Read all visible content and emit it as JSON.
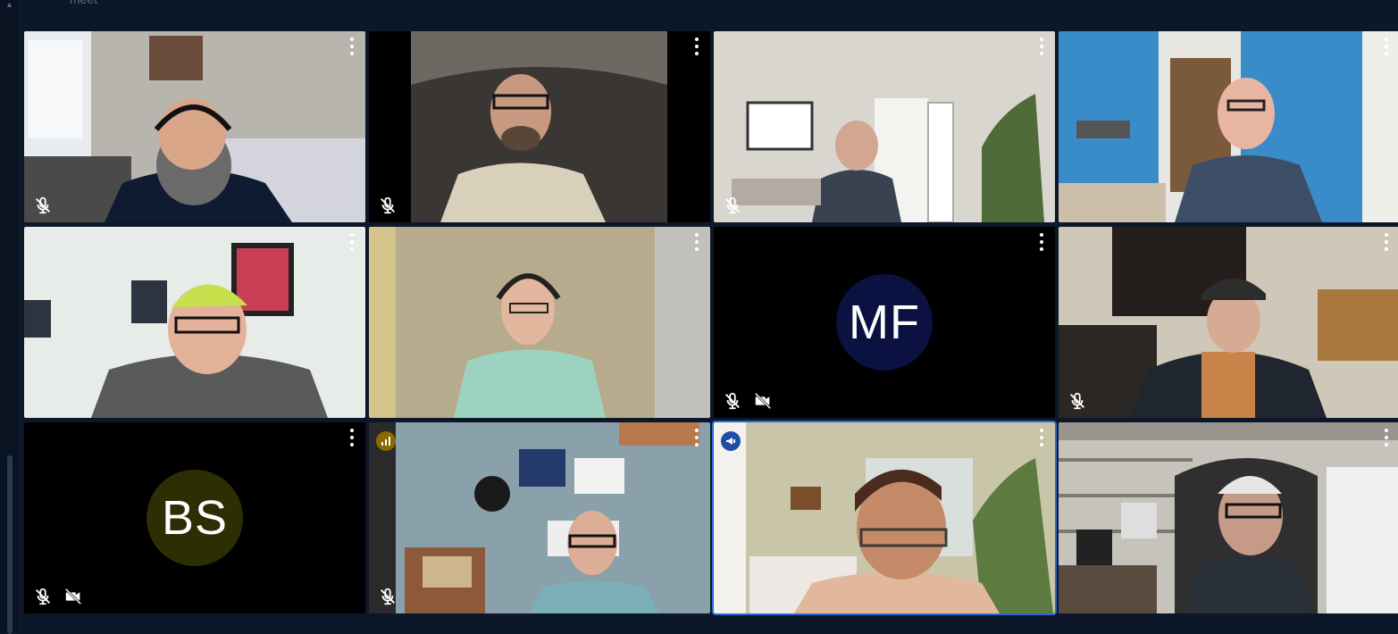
{
  "app": {
    "label": "meet"
  },
  "colors": {
    "background": "#0c1729",
    "active_border": "#2a6bd6",
    "avatar_mf": "#0b1140",
    "avatar_bs": "#2e2e05",
    "speaker_badge": "#1e4fa8",
    "signal_badge": "#8a6a00"
  },
  "participants": [
    {
      "tile": 1,
      "muted": true,
      "camera_off": false
    },
    {
      "tile": 2,
      "muted": true,
      "camera_off": false
    },
    {
      "tile": 3,
      "muted": true,
      "camera_off": false
    },
    {
      "tile": 4,
      "muted": false,
      "camera_off": false
    },
    {
      "tile": 5,
      "muted": false,
      "camera_off": false
    },
    {
      "tile": 6,
      "muted": false,
      "camera_off": false
    },
    {
      "tile": 7,
      "initials": "MF",
      "muted": true,
      "camera_off": true
    },
    {
      "tile": 8,
      "muted": true,
      "camera_off": false
    },
    {
      "tile": 9,
      "initials": "BS",
      "muted": true,
      "camera_off": true,
      "badge": "signal-icon"
    },
    {
      "tile": 10,
      "muted": true,
      "camera_off": false
    },
    {
      "tile": 11,
      "active_speaker": true,
      "badge": "megaphone-icon"
    },
    {
      "tile": 12,
      "muted": false,
      "camera_off": false
    }
  ],
  "icons": {
    "tile_menu": "more-vertical-icon",
    "mic_off": "mic-off-icon",
    "camera_off": "video-off-icon"
  }
}
